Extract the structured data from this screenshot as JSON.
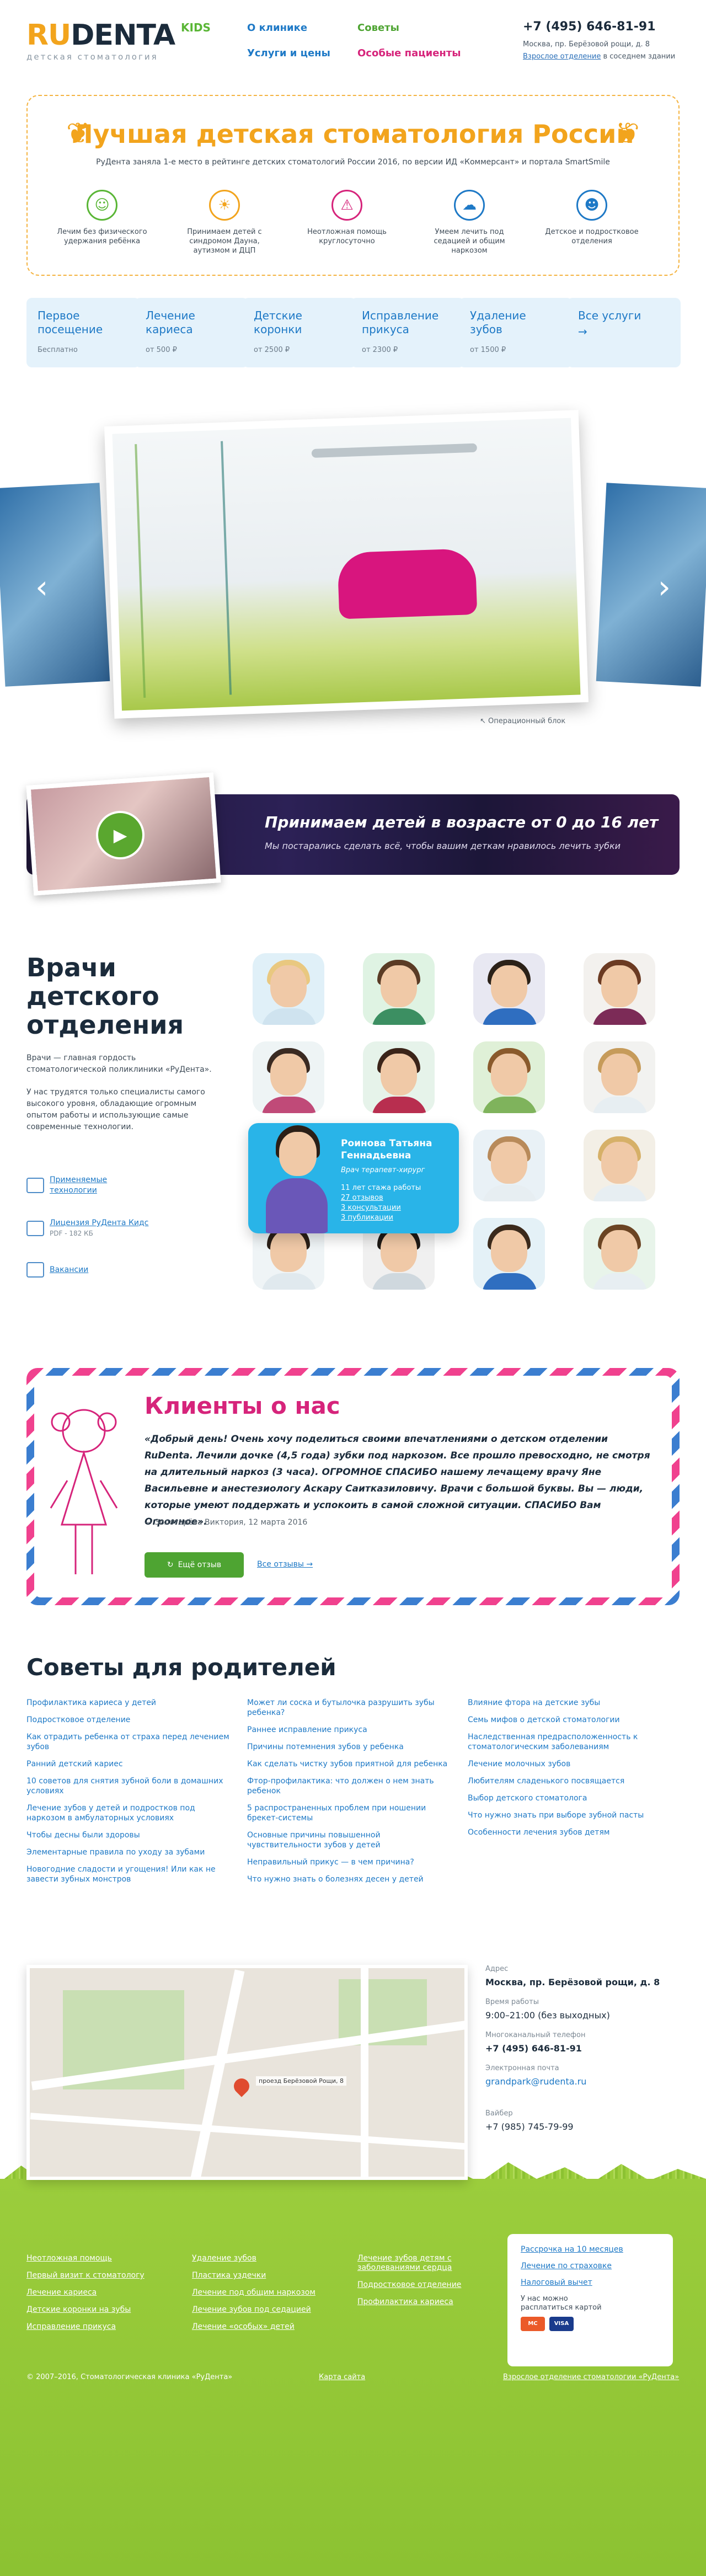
{
  "header": {
    "logo_text_ru": "RU",
    "logo_text_denta": "DENTA",
    "logo_kids": "KIDS",
    "logo_sub": "детская стоматология",
    "nav": [
      {
        "label": "О клинике"
      },
      {
        "label": "Советы"
      },
      {
        "label": "Услуги и цены"
      },
      {
        "label": "Особые пациенты"
      }
    ],
    "phone": "+7 (495) 646-81-91",
    "address": "Москва, пр. Берёзовой рощи, д. 8",
    "adult_link": "Взрослое отделение",
    "adult_suffix": " в соседнем здании"
  },
  "award": {
    "title": "Лучшая детская стоматология России",
    "desc": "РуДента заняла 1-е место в рейтинге детских стоматологий России 2016, по версии ИД «Коммерсант» и портала SmartSmile",
    "features": [
      {
        "icon": "baby-icon",
        "text": "Лечим без физического удержания ребёнка"
      },
      {
        "icon": "sun-icon",
        "text": "Принимаем детей с синдромом Дауна, аутизмом и ДЦП"
      },
      {
        "icon": "siren-icon",
        "text": "Неотложная помощь круглосуточно"
      },
      {
        "icon": "pillow-icon",
        "text": "Умеем лечить под седацией и общим наркозом"
      },
      {
        "icon": "child-face-icon",
        "text": "Детское и подростковое отделения"
      }
    ]
  },
  "services": [
    {
      "title": "Первое посещение",
      "price": "Бесплатно"
    },
    {
      "title": "Лечение кариеса",
      "price": "от 500 ₽"
    },
    {
      "title": "Детские коронки",
      "price": "от 2500 ₽"
    },
    {
      "title": "Исправление прикуса",
      "price": "от 2300 ₽"
    },
    {
      "title": "Удаление зубов",
      "price": "от 1500 ₽"
    },
    {
      "title": "Все услуги",
      "price": "→"
    }
  ],
  "carousel": {
    "prev": "‹",
    "next": "›",
    "caption": "Операционный блок"
  },
  "video": {
    "title": "Принимаем детей в возрасте от 0 до 16 лет",
    "subtitle": "Мы постарались сделать всё, чтобы вашим деткам нравилось лечить зубки"
  },
  "doctors": {
    "heading_1": "Врачи",
    "heading_2": "детского",
    "heading_3": "отделения",
    "p1": "Врачи — главная гордость стоматологической поликлиники «РуДента».",
    "p2": "У нас трудятся только специалисты самого высокого уровня, обладающие огромным опытом работы и использующие самые современные технологии.",
    "link_tech_1": "Применяемые",
    "link_tech_2": "технологии",
    "link_license": "Лицензия РуДента Кидс",
    "license_meta": "PDF - 182 КБ",
    "link_jobs": "Вакансии",
    "featured": {
      "name_1": "Роинова Татьяна",
      "name_2": "Геннадьевна",
      "role": "Врач терапевт-хирург",
      "stats": [
        "11 лет стажа работы",
        "27 отзывов",
        "3 консультации",
        "3 публикации"
      ]
    }
  },
  "review": {
    "title": "Клиенты о нас",
    "text": "«Добрый день! Очень хочу поделиться своими впечатлениями о детском отделении RuDenta. Лечили дочке (4,5 года) зубки под наркозом. Все прошло превосходно, не смотря на длительный наркоз (3 часа). ОГРОМНОЕ СПАСИБО нашему лечащему врачу Яне Васильевне и анестезиологу Аскару Саитказиловичу. Врачи с большой буквы. Вы — люди, которые умеют поддержать и успокоить в самой сложной ситуации. СПАСИБО Вам Огромное».",
    "sign": "— Золотарёва Виктория, 12 марта 2016",
    "btn_more": "Ещё отзыв",
    "all_reviews": "Все отзывы →"
  },
  "tips": {
    "heading": "Советы для родителей",
    "col1": [
      "Профилактика кариеса у детей",
      "Подростковое отделение",
      "Как отрадить ребенка от страха перед лечением зубов",
      "Ранний детский кариес",
      "10 советов для снятия зубной боли в домашних условиях",
      "Лечение зубов у детей и подростков под наркозом в амбулаторных условиях",
      "Чтобы десны были здоровы",
      "Элементарные правила по уходу за зубами",
      "Новогодние сладости и угощения! Или как не завести зубных монстров"
    ],
    "col2": [
      "Может ли соска и бутылочка разрушить зубы ребенка?",
      "Раннее исправление прикуса",
      "Причины потемнения зубов у ребенка",
      "Как сделать чистку зубов приятной для ребенка",
      "Фтор-профилактика: что должен о нем знать ребенок",
      "5 распространенных проблем при ношении брекет-системы",
      "Основные причины повышенной чувствительности зубов у детей",
      "Неправильный прикус — в чем причина?",
      "Что нужно знать о болезнях десен у детей"
    ],
    "col3": [
      "Влияние фтора на детские зубы",
      "Семь мифов о детской стоматологии",
      "Наследственная предрасположенность к стоматологическим заболеваниям",
      "Лечение молочных зубов",
      "Любителям сладенького посвящается",
      "Выбор детского стоматолога",
      "Что нужно знать при выборе зубной пасты",
      "Особенности лечения зубов детям"
    ]
  },
  "contacts": {
    "map_label": "проезд Берёзовой Рощи, 8",
    "addr_label": "Адрес",
    "addr": "Москва, пр. Берёзовой рощи, д. 8",
    "hours_label": "Время работы",
    "hours": "9:00–21:00 (без выходных)",
    "phone_label": "Многоканальный телефон",
    "phone": "+7 (495) 646-81-91",
    "email_label": "Электронная почта",
    "email": "grandpark@rudenta.ru",
    "viber_label": "Вайбер",
    "viber": "+7 (985) 745-79-99"
  },
  "footer": {
    "col1": [
      "Неотложная помощь",
      "Первый визит к стоматологу",
      "Лечение кариеса",
      "Детские коронки на зубы",
      "Исправление прикуса"
    ],
    "col2": [
      "Удаление зубов",
      "Пластика уздечки",
      "Лечение под общим наркозом",
      "Лечение зубов под седацией",
      "Лечение «особых» детей"
    ],
    "col3": [
      "Лечение зубов детям с заболеваниями сердца",
      "Подростковое отделение",
      "Профилактика кариеса"
    ],
    "right": [
      "Рассрочка на 10 месяцев",
      "Лечение по страховке",
      "Налоговый вычет"
    ],
    "pay_1": "У нас можно",
    "pay_2": "расплатиться картой",
    "card_1": "MC",
    "card_2": "VISA",
    "copyright": "© 2007–2016, Стоматологическая клиника «РуДента»",
    "sitemap": "Карта сайта",
    "adult": "Взрослое отделение стоматологии «РуДента»"
  }
}
